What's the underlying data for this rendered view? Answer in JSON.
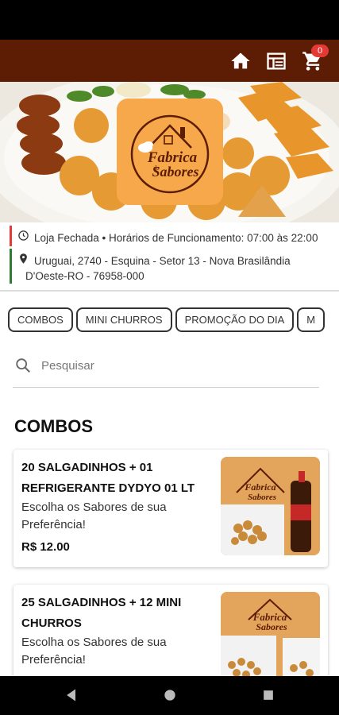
{
  "app_bar": {
    "icons": [
      "home-icon",
      "menu-list-icon",
      "cart-icon"
    ],
    "cart_count": "0",
    "bg_color": "#5c1d04"
  },
  "store": {
    "hours_text": "Loja Fechada • Horários de Funcionamento: 07:00 às 22:00",
    "address_line1": "Uruguai, 2740 - Esquina - Setor 13 - Nova Brasilândia",
    "address_line2": "D'Oeste-RO - 76958-000",
    "status_color": "#e53935",
    "address_color": "#2e7d32"
  },
  "categories": [
    "COMBOS",
    "MINI CHURROS",
    "PROMOÇÃO DO DIA",
    "M"
  ],
  "search": {
    "placeholder": "Pesquisar"
  },
  "section": {
    "title": "COMBOS"
  },
  "products": [
    {
      "name": "20 SALGADINHOS + 01 REFRIGERANTE DYDYO 01 LT",
      "description": "Escolha os Sabores de sua Preferência!",
      "price": "R$ 12.00"
    },
    {
      "name": "25 SALGADINHOS + 12 MINI CHURROS",
      "description": "Escolha os Sabores de sua Preferência!",
      "price": ""
    }
  ],
  "nav": {
    "icons": [
      "back-icon",
      "home-circle-icon",
      "recents-icon"
    ]
  }
}
